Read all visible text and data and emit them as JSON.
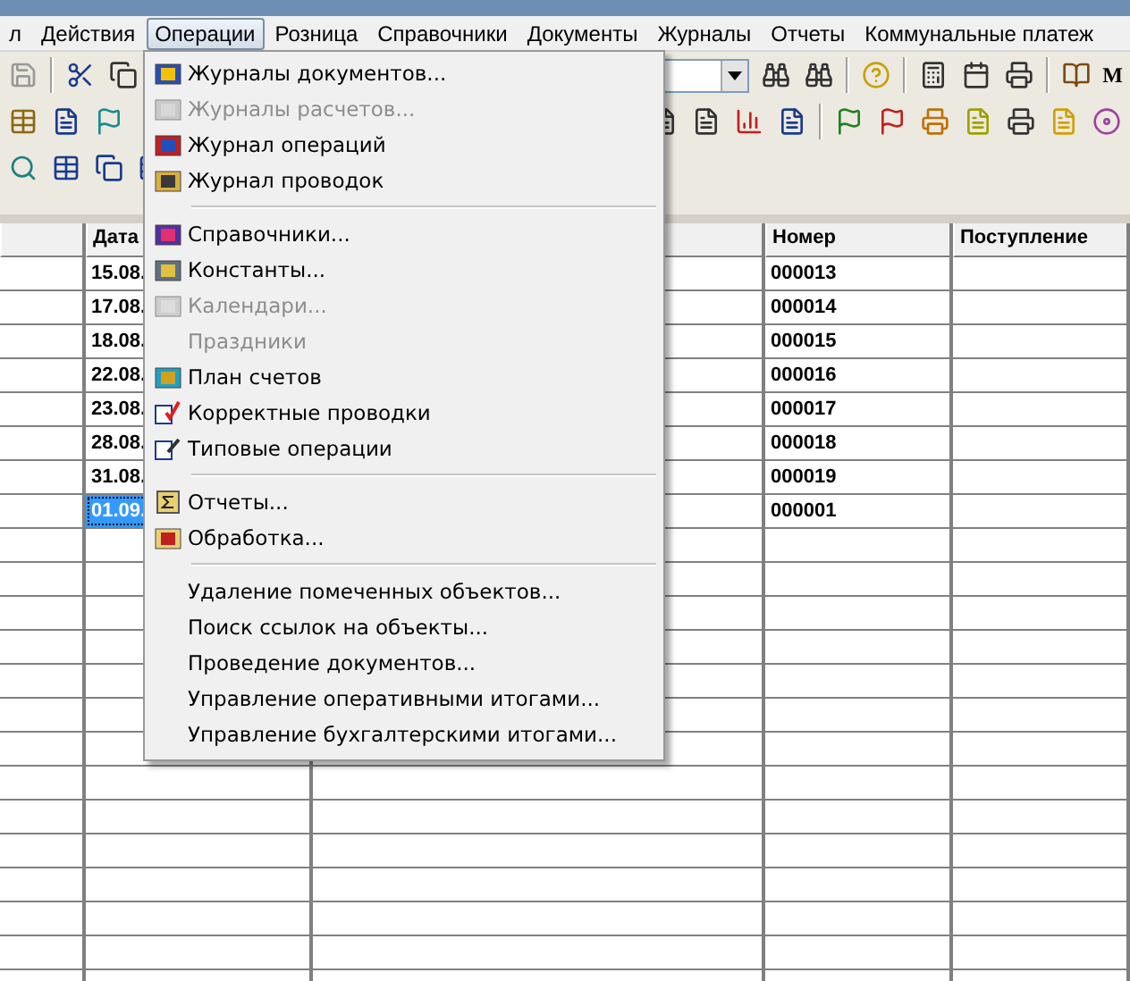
{
  "menubar": [
    {
      "label": "л",
      "selected": false
    },
    {
      "label": "Действия",
      "selected": false
    },
    {
      "label": "Операции",
      "selected": true
    },
    {
      "label": "Розница",
      "selected": false
    },
    {
      "label": "Справочники",
      "selected": false
    },
    {
      "label": "Документы",
      "selected": false
    },
    {
      "label": "Журналы",
      "selected": false
    },
    {
      "label": "Отчеты",
      "selected": false
    },
    {
      "label": "Коммунальные платеж",
      "selected": false
    }
  ],
  "toolbar": {
    "end_label": "М"
  },
  "menu": [
    {
      "kind": "item",
      "label": "Журналы документов...",
      "disabled": false
    },
    {
      "kind": "item",
      "label": "Журналы расчетов...",
      "disabled": true
    },
    {
      "kind": "item",
      "label": "Журнал операций",
      "disabled": false
    },
    {
      "kind": "item",
      "label": "Журнал проводок",
      "disabled": false
    },
    {
      "kind": "separator"
    },
    {
      "kind": "item",
      "label": "Справочники...",
      "disabled": false
    },
    {
      "kind": "item",
      "label": "Константы...",
      "disabled": false
    },
    {
      "kind": "item",
      "label": "Календари...",
      "disabled": true
    },
    {
      "kind": "item",
      "label": "Праздники",
      "disabled": true
    },
    {
      "kind": "item",
      "label": "План счетов",
      "disabled": false
    },
    {
      "kind": "item",
      "label": "Корректные проводки",
      "disabled": false
    },
    {
      "kind": "item",
      "label": "Типовые операции",
      "disabled": false
    },
    {
      "kind": "separator"
    },
    {
      "kind": "item",
      "label": "Отчеты...",
      "disabled": false
    },
    {
      "kind": "item",
      "label": "Обработка...",
      "disabled": false
    },
    {
      "kind": "separator"
    },
    {
      "kind": "item",
      "label": "Удаление помеченных объектов...",
      "disabled": false
    },
    {
      "kind": "item",
      "label": "Поиск ссылок на объекты...",
      "disabled": false
    },
    {
      "kind": "item",
      "label": "Проведение документов...",
      "disabled": false
    },
    {
      "kind": "item",
      "label": "Управление оперативными итогами...",
      "disabled": false
    },
    {
      "kind": "item",
      "label": "Управление бухгалтерскими итогами...",
      "disabled": false
    }
  ],
  "table": {
    "columns": [
      "Дата",
      "Номер",
      "Поступление"
    ],
    "rows": [
      {
        "date": "15.08.",
        "number": "000013",
        "selected": false
      },
      {
        "date": "17.08.",
        "number": "000014",
        "selected": false
      },
      {
        "date": "18.08.",
        "number": "000015",
        "selected": false
      },
      {
        "date": "22.08.",
        "number": "000016",
        "selected": false
      },
      {
        "date": "23.08.",
        "number": "000017",
        "selected": false
      },
      {
        "date": "28.08.",
        "number": "000018",
        "selected": false
      },
      {
        "date": "31.08.",
        "number": "000019",
        "selected": false
      },
      {
        "date": "01.09.",
        "number": "000001",
        "selected": true
      }
    ]
  }
}
